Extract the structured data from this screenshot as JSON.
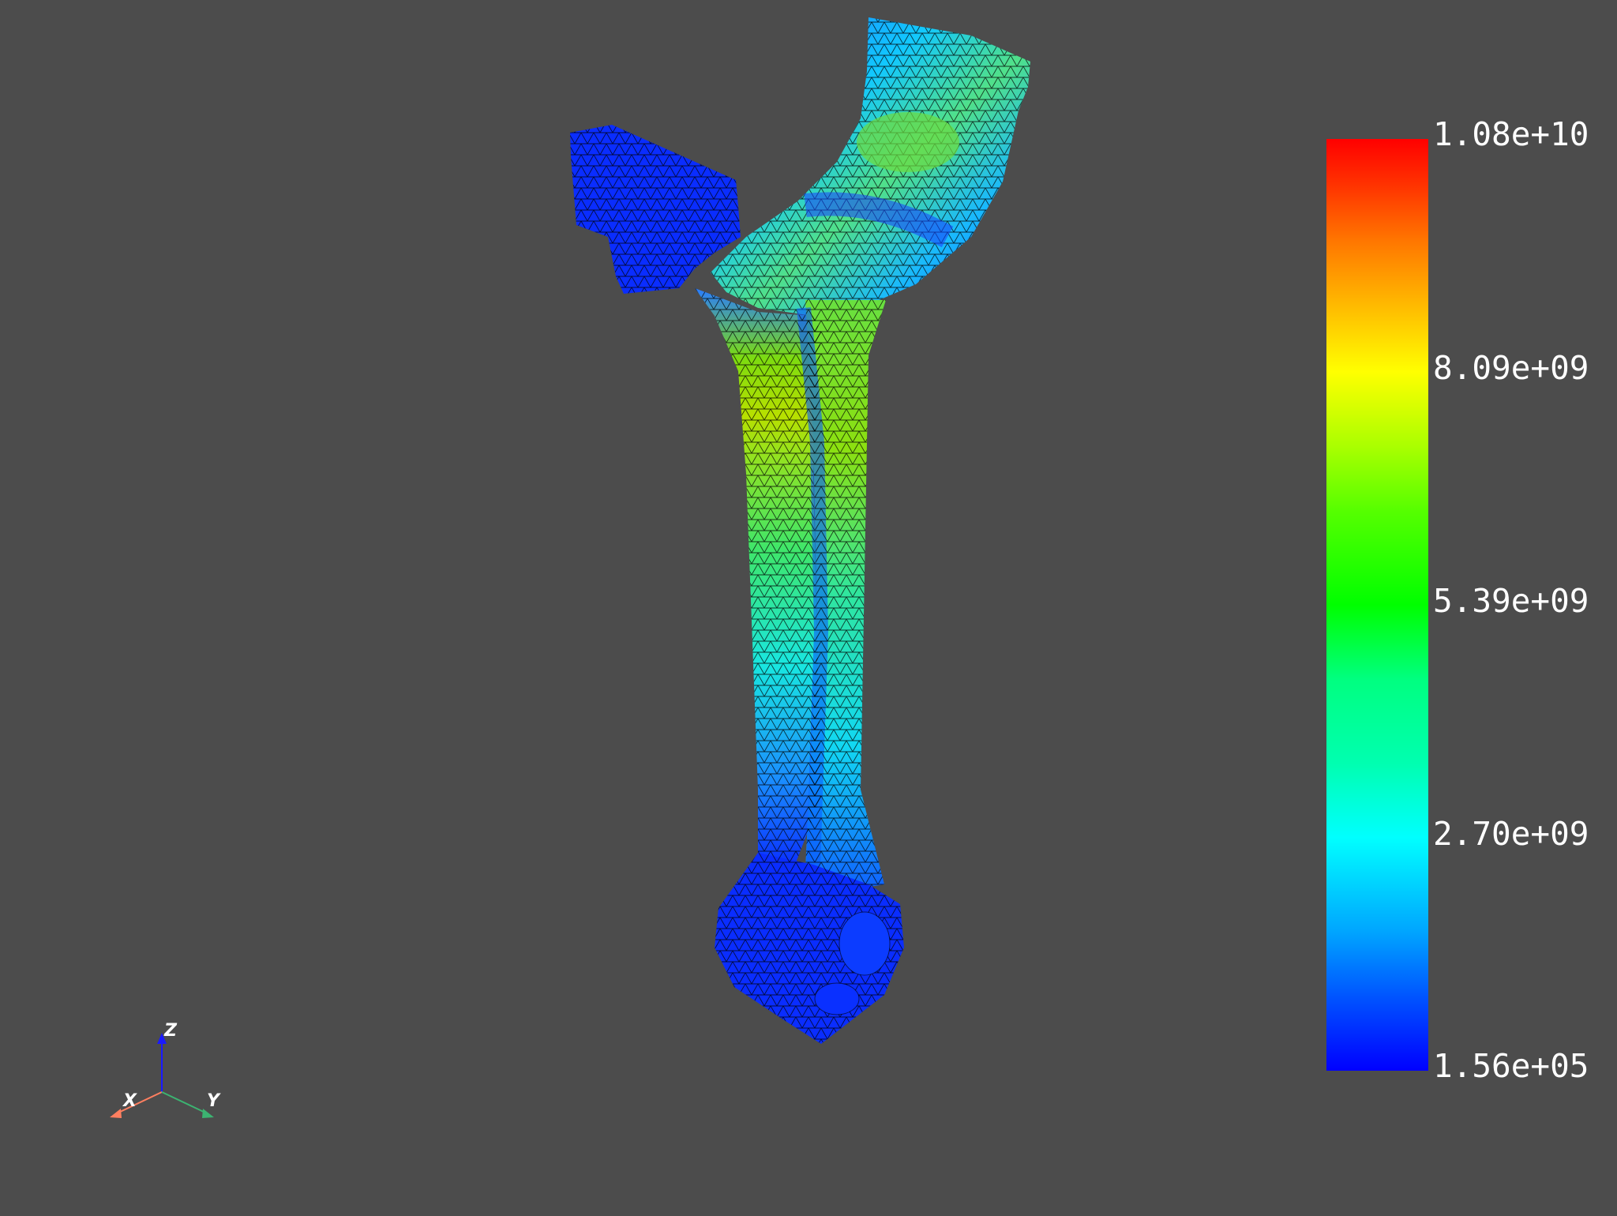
{
  "scalar_bar": {
    "ticks": [
      "1.08e+10",
      "8.09e+09",
      "5.39e+09",
      "2.70e+09",
      "1.56e+05"
    ]
  },
  "orientation_axes": {
    "x_label": "X",
    "y_label": "Y",
    "z_label": "Z",
    "x_color": "#ff7f60",
    "y_color": "#3cb371",
    "z_color": "#1a1aff"
  },
  "model": {
    "name_icon": "connecting-rod-mesh",
    "colormap": "jet",
    "mesh_edges": true
  }
}
